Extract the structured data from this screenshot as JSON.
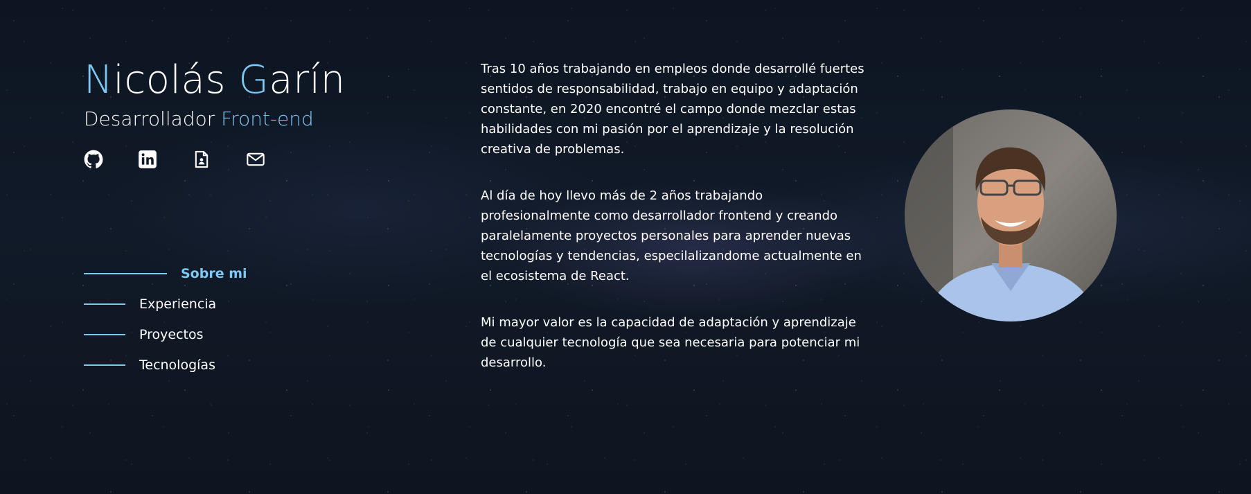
{
  "header": {
    "name_first_initial": "N",
    "name_first_rest": "icolás ",
    "name_last_initial": "G",
    "name_last_rest": "arín",
    "role_prefix": "Desarrollador ",
    "role_highlight": "Front-end"
  },
  "social": [
    {
      "icon": "github-icon"
    },
    {
      "icon": "linkedin-icon"
    },
    {
      "icon": "resume-icon"
    },
    {
      "icon": "mail-icon"
    }
  ],
  "nav": {
    "items": [
      {
        "label": "Sobre mi",
        "active": true
      },
      {
        "label": "Experiencia",
        "active": false
      },
      {
        "label": "Proyectos",
        "active": false
      },
      {
        "label": "Tecnologías",
        "active": false
      }
    ]
  },
  "about": {
    "paragraphs": [
      "Tras 10 años trabajando en empleos donde desarrollé fuertes sentidos de responsabilidad, trabajo en equipo y adaptación constante, en 2020 encontré el campo donde mezclar estas habilidades con mi pasión por el aprendizaje y la resolución creativa de problemas.",
      "Al día de hoy llevo más de 2 años trabajando profesionalmente como desarrollador frontend y creando paralelamente proyectos personales para aprender nuevas tecnologías y tendencias, especilalizandome actualmente en el ecosistema de React.",
      "Mi mayor valor es la capacidad de adaptación y aprendizaje de cualquier tecnología que sea necesaria para potenciar mi desarrollo."
    ]
  },
  "colors": {
    "accent": "#7ec8f4",
    "background": "#111a28",
    "text": "#ffffff"
  }
}
